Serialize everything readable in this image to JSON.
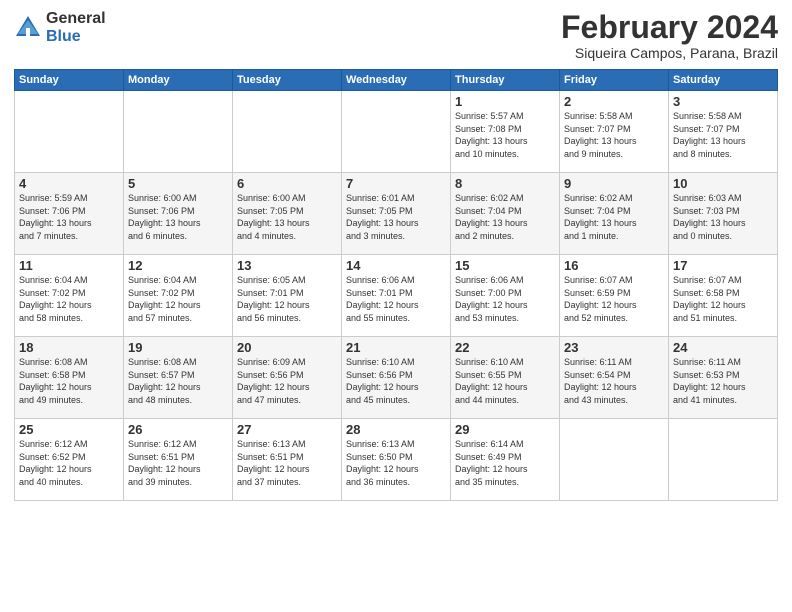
{
  "header": {
    "logo_general": "General",
    "logo_blue": "Blue",
    "title": "February 2024",
    "subtitle": "Siqueira Campos, Parana, Brazil"
  },
  "days_of_week": [
    "Sunday",
    "Monday",
    "Tuesday",
    "Wednesday",
    "Thursday",
    "Friday",
    "Saturday"
  ],
  "weeks": [
    [
      {
        "day": "",
        "info": ""
      },
      {
        "day": "",
        "info": ""
      },
      {
        "day": "",
        "info": ""
      },
      {
        "day": "",
        "info": ""
      },
      {
        "day": "1",
        "info": "Sunrise: 5:57 AM\nSunset: 7:08 PM\nDaylight: 13 hours\nand 10 minutes."
      },
      {
        "day": "2",
        "info": "Sunrise: 5:58 AM\nSunset: 7:07 PM\nDaylight: 13 hours\nand 9 minutes."
      },
      {
        "day": "3",
        "info": "Sunrise: 5:58 AM\nSunset: 7:07 PM\nDaylight: 13 hours\nand 8 minutes."
      }
    ],
    [
      {
        "day": "4",
        "info": "Sunrise: 5:59 AM\nSunset: 7:06 PM\nDaylight: 13 hours\nand 7 minutes."
      },
      {
        "day": "5",
        "info": "Sunrise: 6:00 AM\nSunset: 7:06 PM\nDaylight: 13 hours\nand 6 minutes."
      },
      {
        "day": "6",
        "info": "Sunrise: 6:00 AM\nSunset: 7:05 PM\nDaylight: 13 hours\nand 4 minutes."
      },
      {
        "day": "7",
        "info": "Sunrise: 6:01 AM\nSunset: 7:05 PM\nDaylight: 13 hours\nand 3 minutes."
      },
      {
        "day": "8",
        "info": "Sunrise: 6:02 AM\nSunset: 7:04 PM\nDaylight: 13 hours\nand 2 minutes."
      },
      {
        "day": "9",
        "info": "Sunrise: 6:02 AM\nSunset: 7:04 PM\nDaylight: 13 hours\nand 1 minute."
      },
      {
        "day": "10",
        "info": "Sunrise: 6:03 AM\nSunset: 7:03 PM\nDaylight: 13 hours\nand 0 minutes."
      }
    ],
    [
      {
        "day": "11",
        "info": "Sunrise: 6:04 AM\nSunset: 7:02 PM\nDaylight: 12 hours\nand 58 minutes."
      },
      {
        "day": "12",
        "info": "Sunrise: 6:04 AM\nSunset: 7:02 PM\nDaylight: 12 hours\nand 57 minutes."
      },
      {
        "day": "13",
        "info": "Sunrise: 6:05 AM\nSunset: 7:01 PM\nDaylight: 12 hours\nand 56 minutes."
      },
      {
        "day": "14",
        "info": "Sunrise: 6:06 AM\nSunset: 7:01 PM\nDaylight: 12 hours\nand 55 minutes."
      },
      {
        "day": "15",
        "info": "Sunrise: 6:06 AM\nSunset: 7:00 PM\nDaylight: 12 hours\nand 53 minutes."
      },
      {
        "day": "16",
        "info": "Sunrise: 6:07 AM\nSunset: 6:59 PM\nDaylight: 12 hours\nand 52 minutes."
      },
      {
        "day": "17",
        "info": "Sunrise: 6:07 AM\nSunset: 6:58 PM\nDaylight: 12 hours\nand 51 minutes."
      }
    ],
    [
      {
        "day": "18",
        "info": "Sunrise: 6:08 AM\nSunset: 6:58 PM\nDaylight: 12 hours\nand 49 minutes."
      },
      {
        "day": "19",
        "info": "Sunrise: 6:08 AM\nSunset: 6:57 PM\nDaylight: 12 hours\nand 48 minutes."
      },
      {
        "day": "20",
        "info": "Sunrise: 6:09 AM\nSunset: 6:56 PM\nDaylight: 12 hours\nand 47 minutes."
      },
      {
        "day": "21",
        "info": "Sunrise: 6:10 AM\nSunset: 6:56 PM\nDaylight: 12 hours\nand 45 minutes."
      },
      {
        "day": "22",
        "info": "Sunrise: 6:10 AM\nSunset: 6:55 PM\nDaylight: 12 hours\nand 44 minutes."
      },
      {
        "day": "23",
        "info": "Sunrise: 6:11 AM\nSunset: 6:54 PM\nDaylight: 12 hours\nand 43 minutes."
      },
      {
        "day": "24",
        "info": "Sunrise: 6:11 AM\nSunset: 6:53 PM\nDaylight: 12 hours\nand 41 minutes."
      }
    ],
    [
      {
        "day": "25",
        "info": "Sunrise: 6:12 AM\nSunset: 6:52 PM\nDaylight: 12 hours\nand 40 minutes."
      },
      {
        "day": "26",
        "info": "Sunrise: 6:12 AM\nSunset: 6:51 PM\nDaylight: 12 hours\nand 39 minutes."
      },
      {
        "day": "27",
        "info": "Sunrise: 6:13 AM\nSunset: 6:51 PM\nDaylight: 12 hours\nand 37 minutes."
      },
      {
        "day": "28",
        "info": "Sunrise: 6:13 AM\nSunset: 6:50 PM\nDaylight: 12 hours\nand 36 minutes."
      },
      {
        "day": "29",
        "info": "Sunrise: 6:14 AM\nSunset: 6:49 PM\nDaylight: 12 hours\nand 35 minutes."
      },
      {
        "day": "",
        "info": ""
      },
      {
        "day": "",
        "info": ""
      }
    ]
  ]
}
